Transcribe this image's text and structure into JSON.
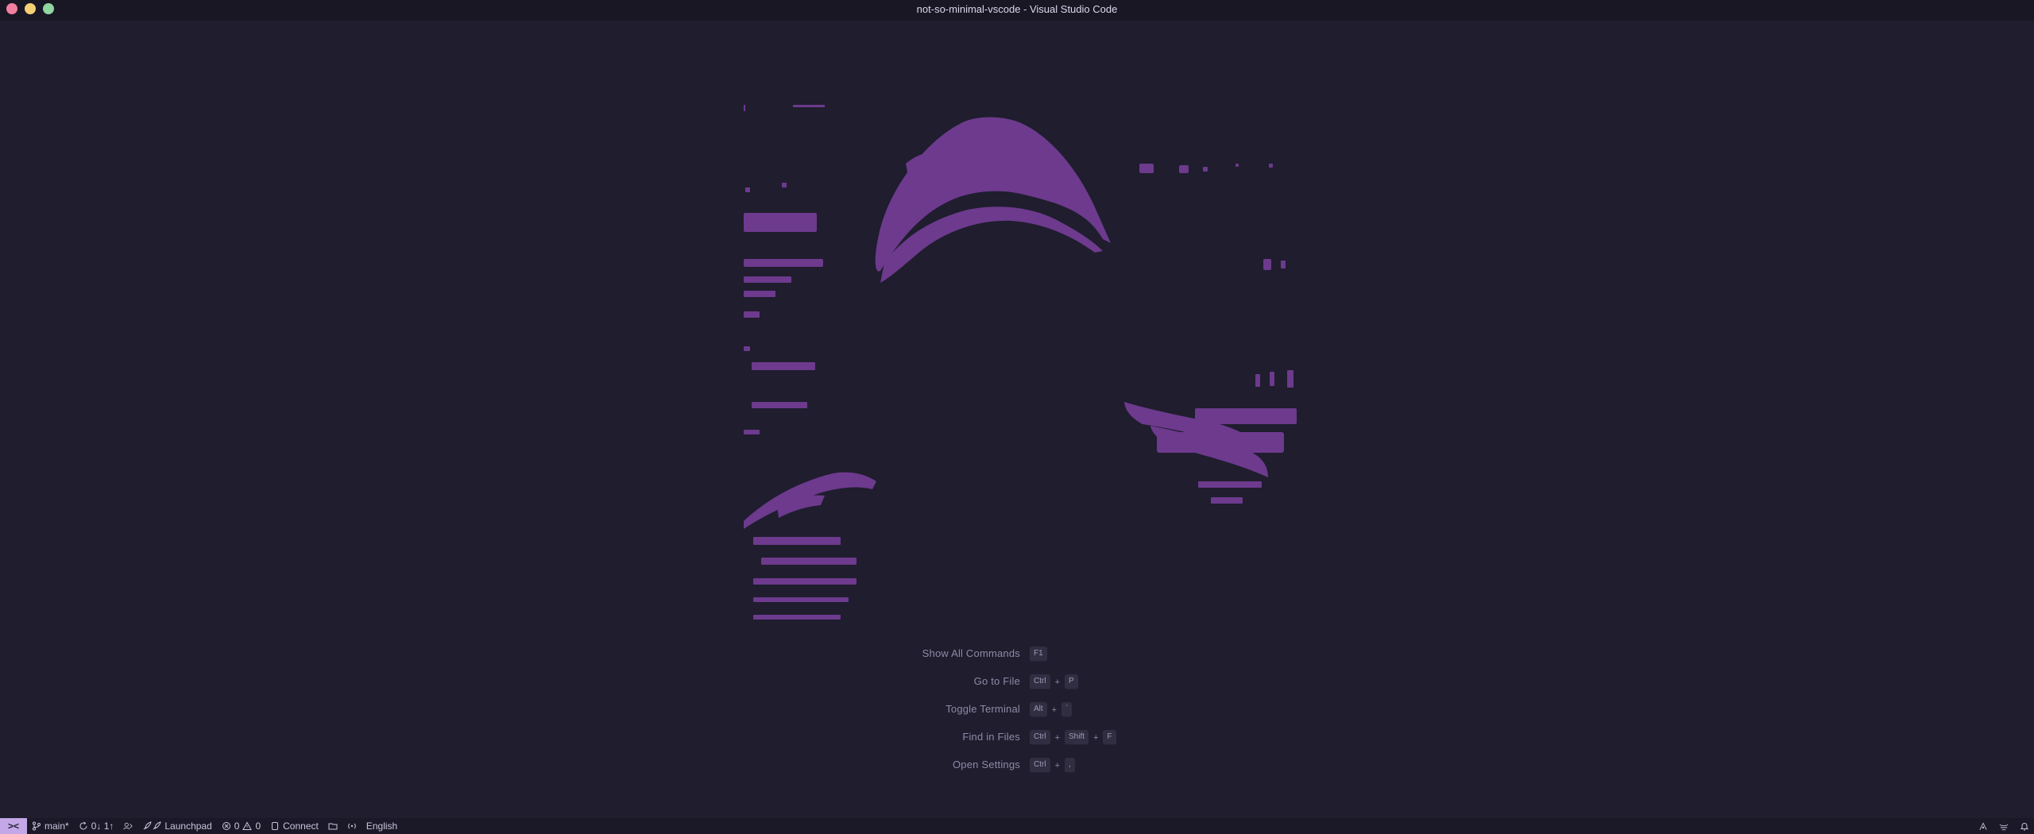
{
  "window": {
    "title": "not-so-minimal-vscode - Visual Studio Code"
  },
  "colors": {
    "background": "#1f1d2e",
    "titlebar": "#191724",
    "accent": "#c4a7e7",
    "watermark": "#6d3a8e"
  },
  "shortcuts": [
    {
      "label": "Show All Commands",
      "keys": [
        "F1"
      ]
    },
    {
      "label": "Go to File",
      "keys": [
        "Ctrl",
        "P"
      ]
    },
    {
      "label": "Toggle Terminal",
      "keys": [
        "Alt",
        "`"
      ]
    },
    {
      "label": "Find in Files",
      "keys": [
        "Ctrl",
        "Shift",
        "F"
      ]
    },
    {
      "label": "Open Settings",
      "keys": [
        "Ctrl",
        ","
      ]
    }
  ],
  "key_joiner": "+",
  "statusbar": {
    "remote_icon": "remote-icon",
    "branch": "main*",
    "sync": "0↓ 1↑",
    "launchpad": "Launchpad",
    "errors": "0",
    "warnings": "0",
    "connect": "Connect",
    "language": "English"
  }
}
